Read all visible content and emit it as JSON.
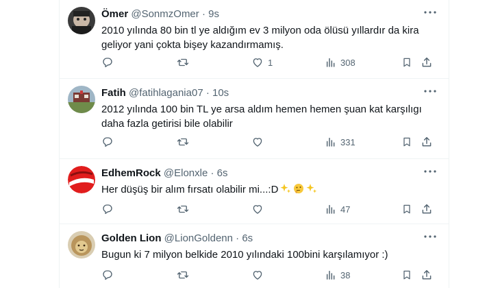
{
  "tweets": [
    {
      "name": "Ömer",
      "handle": "@SonmzOmer",
      "time": "9s",
      "text": "2010 yılında 80 bin tl ye aldığım ev 3 milyon oda ölüsü yıllardır da kira geliyor yani çokta bişey kazandırmamış.",
      "likes": "1",
      "views": "308"
    },
    {
      "name": "Fatih",
      "handle": "@fatihlagania07",
      "time": "10s",
      "text": "2012 yılında 100 bin TL ye arsa aldım hemen hemen şuan kat karşılıgı daha fazla getirisi bile olabilir",
      "likes": "",
      "views": "331"
    },
    {
      "name": "EdhemRock",
      "handle": "@Elonxle",
      "time": "6s",
      "text": "Her düşüş bir alım fırsatı olabilir mi...:D",
      "emojis": [
        "sparkles-emoji",
        "thinking-face-emoji",
        "sparkles-emoji"
      ],
      "likes": "",
      "views": "47"
    },
    {
      "name": "Golden Lion",
      "handle": "@LionGoldenn",
      "time": "6s",
      "text": "Bugun ki 7 milyon belkide 2010 yılındaki 100bini karşılamıyor :)",
      "likes": "",
      "views": "38"
    }
  ],
  "separator": "·",
  "icons": [
    "more-icon",
    "reply-icon",
    "retweet-icon",
    "like-icon",
    "views-icon",
    "bookmark-icon",
    "share-icon"
  ],
  "colors": {
    "text": "#0f1419",
    "secondary": "#536471",
    "divider": "#eff3f4"
  }
}
